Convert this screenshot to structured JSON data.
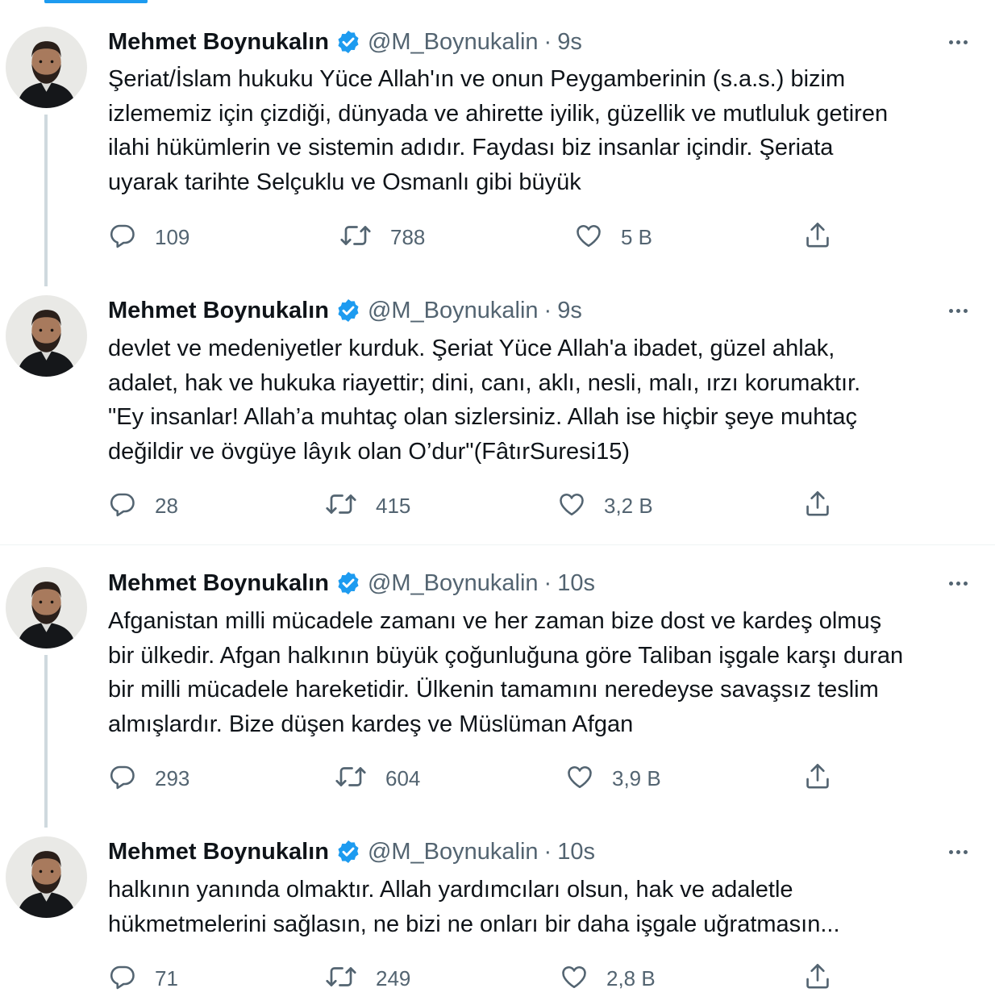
{
  "author": {
    "name": "Mehmet Boynukalın",
    "handle": "@M_Boynukalin",
    "verified": true
  },
  "colors": {
    "accent": "#1d9bf0",
    "text": "#0f1419",
    "secondary": "#536471",
    "thread_line": "#cfd9de"
  },
  "icons": {
    "reply": "reply-icon",
    "retweet": "retweet-icon",
    "like": "like-icon",
    "share": "share-icon",
    "verified": "verified-badge-icon",
    "more": "more-icon"
  },
  "tweets": [
    {
      "time": "9s",
      "text": "Şeriat/İslam hukuku Yüce Allah'ın ve onun Peygamberinin (s.a.s.) bizim\nizlememiz için çizdiği, dünyada ve ahirette iyilik, güzellik ve mutluluk getiren\nilahi hükümlerin ve sistemin adıdır. Faydası biz insanlar içindir. Şeriata\nuyarak tarihte Selçuklu ve Osmanlı gibi büyük",
      "replies": "109",
      "retweets": "788",
      "likes": "5 B"
    },
    {
      "time": "9s",
      "text": "devlet ve medeniyetler kurduk. Şeriat Yüce Allah'a ibadet, güzel ahlak,\nadalet, hak ve hukuka riayettir; dini, canı, aklı, nesli, malı, ırzı korumaktır.\n\"Ey insanlar! Allah’a muhtaç olan sizlersiniz. Allah ise hiçbir şeye muhtaç\ndeğildir ve övgüye lâyık olan O’dur\"(FâtırSuresi15)",
      "replies": "28",
      "retweets": "415",
      "likes": "3,2 B"
    },
    {
      "time": "10s",
      "text": "Afganistan milli mücadele zamanı ve her zaman bize dost ve kardeş olmuş\nbir ülkedir. Afgan halkının büyük çoğunluğuna göre Taliban işgale karşı duran\nbir milli mücadele hareketidir. Ülkenin tamamını neredeyse savaşsız teslim\nalmışlardır. Bize düşen kardeş ve Müslüman Afgan",
      "replies": "293",
      "retweets": "604",
      "likes": "3,9 B"
    },
    {
      "time": "10s",
      "text": "halkının yanında  olmaktır. Allah yardımcıları olsun, hak ve adaletle\nhükmetmelerini sağlasın, ne bizi ne onları bir daha işgale uğratmasın...",
      "replies": "71",
      "retweets": "249",
      "likes": "2,8 B"
    }
  ]
}
